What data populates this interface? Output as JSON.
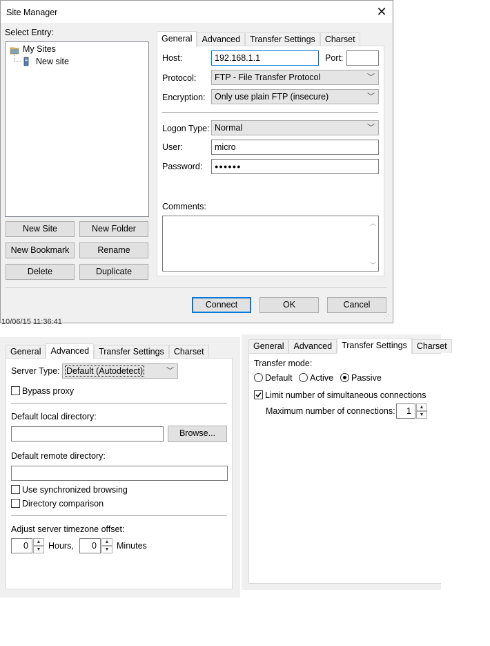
{
  "window": {
    "title": "Site Manager",
    "close_icon": "close-icon"
  },
  "select_entry_label": "Select Entry:",
  "tree": {
    "root": "My Sites",
    "child": "New site"
  },
  "left_buttons": {
    "new_site": "New Site",
    "new_folder": "New Folder",
    "new_bookmark": "New Bookmark",
    "rename": "Rename",
    "delete": "Delete",
    "duplicate": "Duplicate"
  },
  "tabs": [
    "General",
    "Advanced",
    "Transfer Settings",
    "Charset"
  ],
  "general": {
    "host_label": "Host:",
    "host_value": "192.168.1.1",
    "port_label": "Port:",
    "port_value": "",
    "protocol_label": "Protocol:",
    "protocol_value": "FTP - File Transfer Protocol",
    "encryption_label": "Encryption:",
    "encryption_value": "Only use plain FTP (insecure)",
    "logon_label": "Logon Type:",
    "logon_value": "Normal",
    "user_label": "User:",
    "user_value": "micro",
    "password_label": "Password:",
    "password_value": "●●●●●●",
    "comments_label": "Comments:"
  },
  "bottom_buttons": {
    "connect": "Connect",
    "ok": "OK",
    "cancel": "Cancel"
  },
  "timestamp": "10/06/15 11:36:41",
  "advanced": {
    "server_type_label": "Server Type:",
    "server_type_value": "Default (Autodetect)",
    "bypass_proxy": "Bypass proxy",
    "local_dir_label": "Default local directory:",
    "local_dir_value": "",
    "browse": "Browse...",
    "remote_dir_label": "Default remote directory:",
    "remote_dir_value": "",
    "sync_browsing": "Use synchronized browsing",
    "dir_comparison": "Directory comparison",
    "timezone_label": "Adjust server timezone offset:",
    "hours_value": "0",
    "hours_label": "Hours,",
    "minutes_value": "0",
    "minutes_label": "Minutes"
  },
  "transfer": {
    "mode_label": "Transfer mode:",
    "mode_default": "Default",
    "mode_active": "Active",
    "mode_passive": "Passive",
    "selected_mode": "Passive",
    "limit_label": "Limit number of simultaneous connections",
    "limit_checked": true,
    "max_label": "Maximum number of connections:",
    "max_value": "1"
  }
}
